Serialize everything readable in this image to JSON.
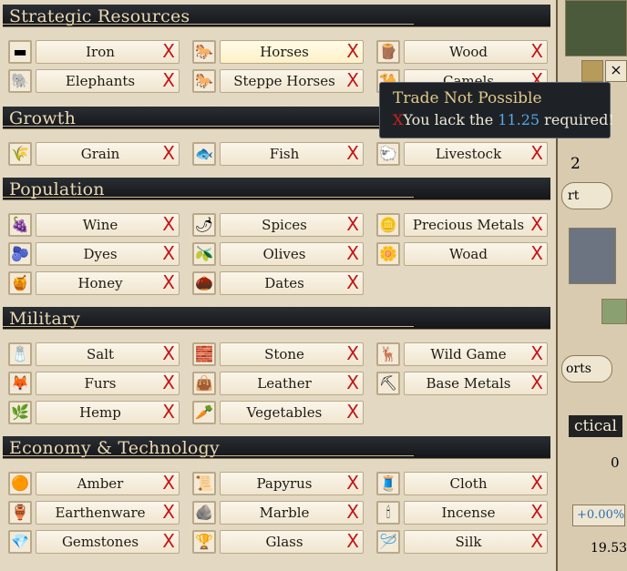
{
  "sections": [
    {
      "title": "Strategic Resources",
      "rows": [
        [
          {
            "label": "Iron",
            "icon": "iron-icon",
            "glyph": "▬"
          },
          {
            "label": "Horses",
            "icon": "horse-icon",
            "glyph": "🐎",
            "highlight": true
          },
          {
            "label": "Wood",
            "icon": "wood-icon",
            "glyph": "🪵"
          }
        ],
        [
          {
            "label": "Elephants",
            "icon": "elephant-icon",
            "glyph": "🐘"
          },
          {
            "label": "Steppe Horses",
            "icon": "steppe-horse-icon",
            "glyph": "🐎"
          },
          {
            "label": "Camels",
            "icon": "camel-icon",
            "glyph": "🐪"
          }
        ]
      ]
    },
    {
      "title": "Growth",
      "rows": [
        [
          {
            "label": "Grain",
            "icon": "grain-icon",
            "glyph": "🌾"
          },
          {
            "label": "Fish",
            "icon": "fish-icon",
            "glyph": "🐟"
          },
          {
            "label": "Livestock",
            "icon": "livestock-icon",
            "glyph": "🐑"
          }
        ]
      ]
    },
    {
      "title": "Population",
      "rows": [
        [
          {
            "label": "Wine",
            "icon": "wine-icon",
            "glyph": "🍇"
          },
          {
            "label": "Spices",
            "icon": "spices-icon",
            "glyph": "🌶"
          },
          {
            "label": "Precious Metals",
            "icon": "precious-metals-icon",
            "glyph": "🪙"
          }
        ],
        [
          {
            "label": "Dyes",
            "icon": "dyes-icon",
            "glyph": "🫐"
          },
          {
            "label": "Olives",
            "icon": "olives-icon",
            "glyph": "🫒"
          },
          {
            "label": "Woad",
            "icon": "woad-icon",
            "glyph": "🌼"
          }
        ],
        [
          {
            "label": "Honey",
            "icon": "honey-icon",
            "glyph": "🍯"
          },
          {
            "label": "Dates",
            "icon": "dates-icon",
            "glyph": "🌰"
          }
        ]
      ]
    },
    {
      "title": "Military",
      "rows": [
        [
          {
            "label": "Salt",
            "icon": "salt-icon",
            "glyph": "🧂"
          },
          {
            "label": "Stone",
            "icon": "stone-icon",
            "glyph": "🧱"
          },
          {
            "label": "Wild Game",
            "icon": "wild-game-icon",
            "glyph": "🦌"
          }
        ],
        [
          {
            "label": "Furs",
            "icon": "furs-icon",
            "glyph": "🦊"
          },
          {
            "label": "Leather",
            "icon": "leather-icon",
            "glyph": "👜"
          },
          {
            "label": "Base Metals",
            "icon": "base-metals-icon",
            "glyph": "⛏"
          }
        ],
        [
          {
            "label": "Hemp",
            "icon": "hemp-icon",
            "glyph": "🌿"
          },
          {
            "label": "Vegetables",
            "icon": "vegetables-icon",
            "glyph": "🥕"
          }
        ]
      ]
    },
    {
      "title": "Economy & Technology",
      "rows": [
        [
          {
            "label": "Amber",
            "icon": "amber-icon",
            "glyph": "🟠"
          },
          {
            "label": "Papyrus",
            "icon": "papyrus-icon",
            "glyph": "📜"
          },
          {
            "label": "Cloth",
            "icon": "cloth-icon",
            "glyph": "🧵"
          }
        ],
        [
          {
            "label": "Earthenware",
            "icon": "earthenware-icon",
            "glyph": "🏺"
          },
          {
            "label": "Marble",
            "icon": "marble-icon",
            "glyph": "🪨"
          },
          {
            "label": "Incense",
            "icon": "incense-icon",
            "glyph": "🕯"
          }
        ],
        [
          {
            "label": "Gemstones",
            "icon": "gemstones-icon",
            "glyph": "💎"
          },
          {
            "label": "Glass",
            "icon": "glass-icon",
            "glyph": "🏆"
          },
          {
            "label": "Silk",
            "icon": "silk-icon",
            "glyph": "🪡"
          }
        ]
      ]
    }
  ],
  "x_mark": "X",
  "tooltip": {
    "title": "Trade Not Possible",
    "x_mark": "X",
    "msg_prefix": "You lack the ",
    "value": "11.25",
    "msg_suffix": " required!"
  },
  "right_panel": {
    "number": "2",
    "button_partial": "rt",
    "button2_partial": "orts",
    "tab_partial": "ctical",
    "zero": "0",
    "percent": "+0.00%",
    "stat": "19.53"
  },
  "colors": {
    "x_red": "#c41616",
    "tooltip_value": "#58a8e8",
    "header_text": "#e9d9b4"
  }
}
